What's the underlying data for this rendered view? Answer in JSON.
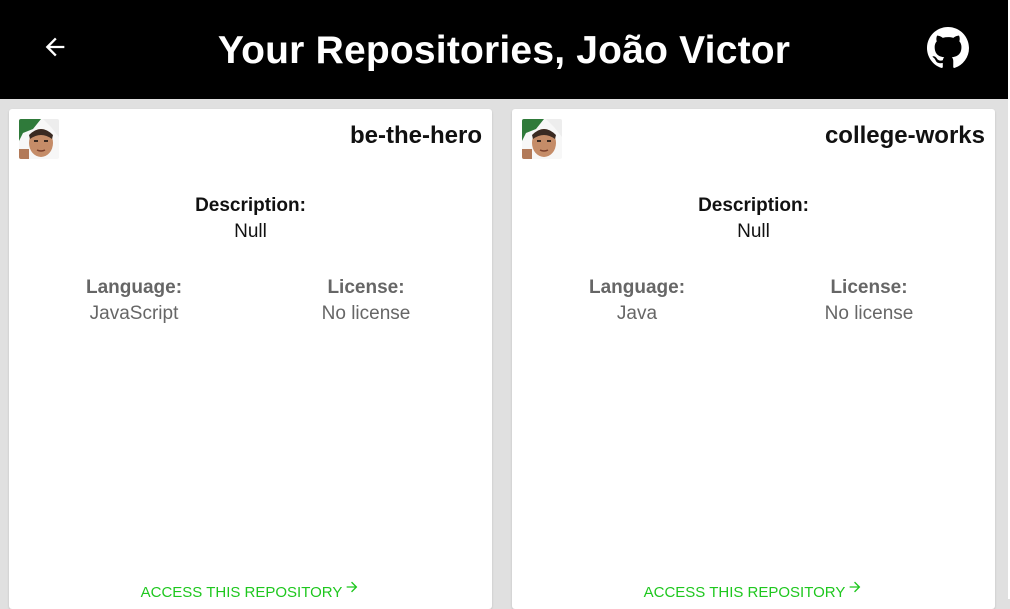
{
  "header": {
    "title": "Your Repositories, João Victor",
    "back_icon": "arrow-left-icon",
    "github_icon": "github-icon"
  },
  "colors": {
    "header_bg": "#000000",
    "page_bg": "#e0e0e0",
    "card_bg": "#ffffff",
    "link": "#1ec71e",
    "muted_text": "#666666"
  },
  "repos": [
    {
      "name": "be-the-hero",
      "description_label": "Description:",
      "description_value": "Null",
      "language_label": "Language:",
      "language_value": "JavaScript",
      "license_label": "License:",
      "license_value": "No license",
      "access_label": "ACCESS THIS REPOSITORY"
    },
    {
      "name": "college-works",
      "description_label": "Description:",
      "description_value": "Null",
      "language_label": "Language:",
      "language_value": "Java",
      "license_label": "License:",
      "license_value": "No license",
      "access_label": "ACCESS THIS REPOSITORY"
    }
  ]
}
